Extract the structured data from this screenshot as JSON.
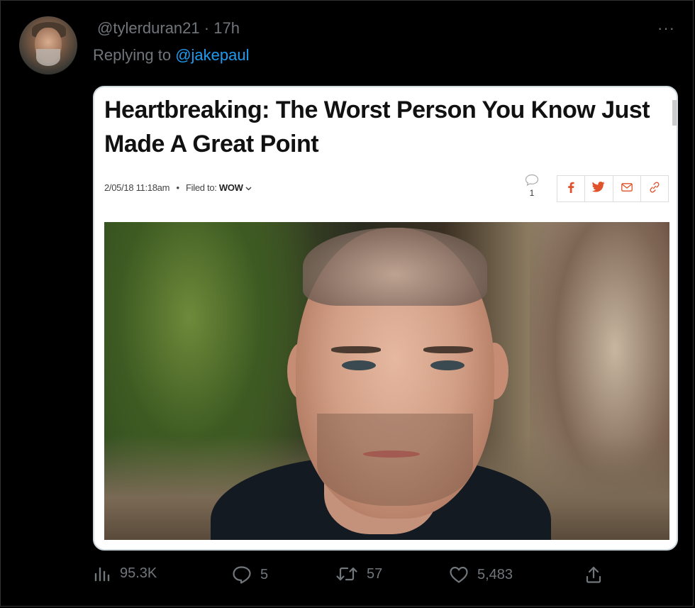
{
  "tweet": {
    "handle": "@tylerduran21",
    "separator": "·",
    "time": "17h",
    "more_label": "···",
    "replying_prefix": "Replying to",
    "replying_to": "@jakepaul",
    "avatar_icon": "user-avatar"
  },
  "article": {
    "headline": "Heartbreaking: The Worst Person You Know Just Made A Great Point",
    "date": "2/05/18 11:18am",
    "meta_dot": "•",
    "filed_label": "Filed to:",
    "filed_tag": "WOW",
    "comment_count": "1",
    "share_icons": [
      "facebook-icon",
      "twitter-icon",
      "email-icon",
      "link-icon"
    ],
    "share_color": "#e0522b"
  },
  "actions": {
    "views": "95.3K",
    "replies": "5",
    "retweets": "57",
    "likes": "5,483"
  },
  "colors": {
    "background": "#000000",
    "muted": "#71767b",
    "link": "#1d9bf0"
  }
}
